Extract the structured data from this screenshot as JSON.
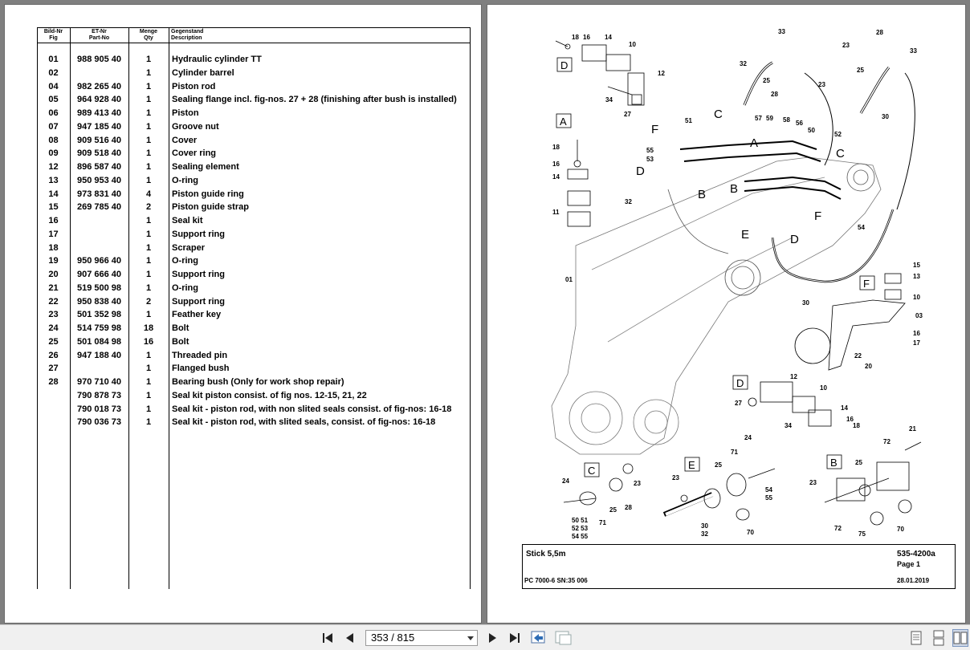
{
  "table": {
    "headers": [
      {
        "de": "Bild-Nr",
        "en": "Fig"
      },
      {
        "de": "ET-Nr",
        "en": "Part-No"
      },
      {
        "de": "Menge",
        "en": "Qty"
      },
      {
        "de": "Gegenstand",
        "en": "Description"
      }
    ],
    "rows": [
      {
        "fig": "01",
        "part": "988 905 40",
        "qty": "1",
        "desc": "Hydraulic cylinder TT"
      },
      {
        "fig": "02",
        "part": "",
        "qty": "1",
        "desc": "Cylinder barrel"
      },
      {
        "fig": "04",
        "part": "982 265 40",
        "qty": "1",
        "desc": "Piston rod"
      },
      {
        "fig": "05",
        "part": "964 928 40",
        "qty": "1",
        "desc": "Sealing flange incl. fig-nos. 27 + 28  (finishing after bush is installed)"
      },
      {
        "fig": "06",
        "part": "989 413 40",
        "qty": "1",
        "desc": "Piston"
      },
      {
        "fig": "07",
        "part": "947 185 40",
        "qty": "1",
        "desc": "Groove nut"
      },
      {
        "fig": "08",
        "part": "909 516 40",
        "qty": "1",
        "desc": "Cover"
      },
      {
        "fig": "09",
        "part": "909 518 40",
        "qty": "1",
        "desc": "Cover ring"
      },
      {
        "fig": "12",
        "part": "896 587 40",
        "qty": "1",
        "desc": "Sealing element"
      },
      {
        "fig": "13",
        "part": "950 953 40",
        "qty": "1",
        "desc": "O-ring"
      },
      {
        "fig": "14",
        "part": "973 831 40",
        "qty": "4",
        "desc": "Piston guide ring"
      },
      {
        "fig": "15",
        "part": "269 785 40",
        "qty": "2",
        "desc": "Piston guide strap"
      },
      {
        "fig": "16",
        "part": "",
        "qty": "1",
        "desc": "Seal kit"
      },
      {
        "fig": "17",
        "part": "",
        "qty": "1",
        "desc": "Support ring"
      },
      {
        "fig": "18",
        "part": "",
        "qty": "1",
        "desc": "Scraper"
      },
      {
        "fig": "19",
        "part": "950 966 40",
        "qty": "1",
        "desc": "O-ring"
      },
      {
        "fig": "20",
        "part": "907 666 40",
        "qty": "1",
        "desc": "Support ring"
      },
      {
        "fig": "21",
        "part": "519 500 98",
        "qty": "1",
        "desc": "O-ring"
      },
      {
        "fig": "22",
        "part": "950 838 40",
        "qty": "2",
        "desc": "Support ring"
      },
      {
        "fig": "23",
        "part": "501 352 98",
        "qty": "1",
        "desc": "Feather key"
      },
      {
        "fig": "24",
        "part": "514 759 98",
        "qty": "18",
        "desc": "Bolt"
      },
      {
        "fig": "25",
        "part": "501 084 98",
        "qty": "16",
        "desc": "Bolt"
      },
      {
        "fig": "26",
        "part": "947 188 40",
        "qty": "1",
        "desc": "Threaded pin"
      },
      {
        "fig": "27",
        "part": "",
        "qty": "1",
        "desc": "Flanged bush"
      },
      {
        "fig": "28",
        "part": "970 710 40",
        "qty": "1",
        "desc": "Bearing bush (Only for work shop repair)"
      },
      {
        "fig": "",
        "part": "790 878 73",
        "qty": "1",
        "desc": "Seal kit piston consist. of fig nos. 12-15, 21, 22"
      },
      {
        "fig": "",
        "part": "790 018 73",
        "qty": "1",
        "desc": "Seal kit - piston rod, with non slited seals consist. of fig-nos: 16-18"
      },
      {
        "fig": "",
        "part": "790 036 73",
        "qty": "1",
        "desc": "Seal kit - piston rod, with slited seals, consist. of fig-nos: 16-18"
      }
    ]
  },
  "drawing": {
    "box_letters": {
      "D1": "D",
      "A": "A",
      "F": "F",
      "D2": "D",
      "C": "C",
      "E": "E",
      "B": "B"
    },
    "callouts": {
      "l18a": "18",
      "l16a": "16",
      "l14a": "14",
      "l10a": "10",
      "l12a": "12",
      "l34a": "34",
      "l27a": "27",
      "l33a": "33",
      "l28a": "28",
      "l23a": "23",
      "l33b": "33",
      "l32a": "32",
      "l25a": "25",
      "l23b": "23",
      "l28b": "28",
      "l25b": "25",
      "l30a": "30",
      "l18b": "18",
      "l16b": "16",
      "l14b": "14",
      "l11b": "11",
      "l51": "51",
      "l55": "55",
      "l53": "53",
      "l57": "57",
      "l59": "59",
      "l58": "58",
      "l56": "56",
      "l50": "50",
      "l52": "52",
      "l54": "54",
      "l32b": "32",
      "l01": "01",
      "l30b": "30",
      "l15f": "15",
      "l13f": "13",
      "l10f": "10",
      "l03f": "03",
      "l16f": "16",
      "l17f": "17",
      "l22f": "22",
      "l20f": "20",
      "l12d": "12",
      "l10d": "10",
      "l27d": "27",
      "l14d": "14",
      "l16d": "16",
      "l18d": "18",
      "l34d": "34",
      "l24c": "24",
      "l23c": "23",
      "l25c": "25",
      "l28c": "28",
      "l71c": "71",
      "l5051": "50 51",
      "l5253": "52 53",
      "l5455": "54 55",
      "l24e": "24",
      "l71e": "71",
      "l25e": "25",
      "l23e": "23",
      "l54e": "54",
      "l55e": "55",
      "l30e": "30",
      "l32e": "32",
      "l70e": "70",
      "l21b": "21",
      "l72b": "72",
      "l25bb": "25",
      "l23bb": "23",
      "l72bb": "72",
      "l75b": "75",
      "l70b": "70"
    },
    "arrows": {
      "C1": "C",
      "F1": "F",
      "A1": "A",
      "C2": "C",
      "D3": "D",
      "B1": "B",
      "B2": "B",
      "F2": "F",
      "E1": "E",
      "D4": "D"
    }
  },
  "title_block": {
    "name": "Stick 5,5m",
    "doc_no": "535-4200a",
    "page": "Page 1",
    "model": "PC 7000-6 SN:35 006",
    "date": "28.01.2019"
  },
  "toolbar": {
    "page_current": "353",
    "page_total": "815",
    "page_display": "353 / 815"
  }
}
